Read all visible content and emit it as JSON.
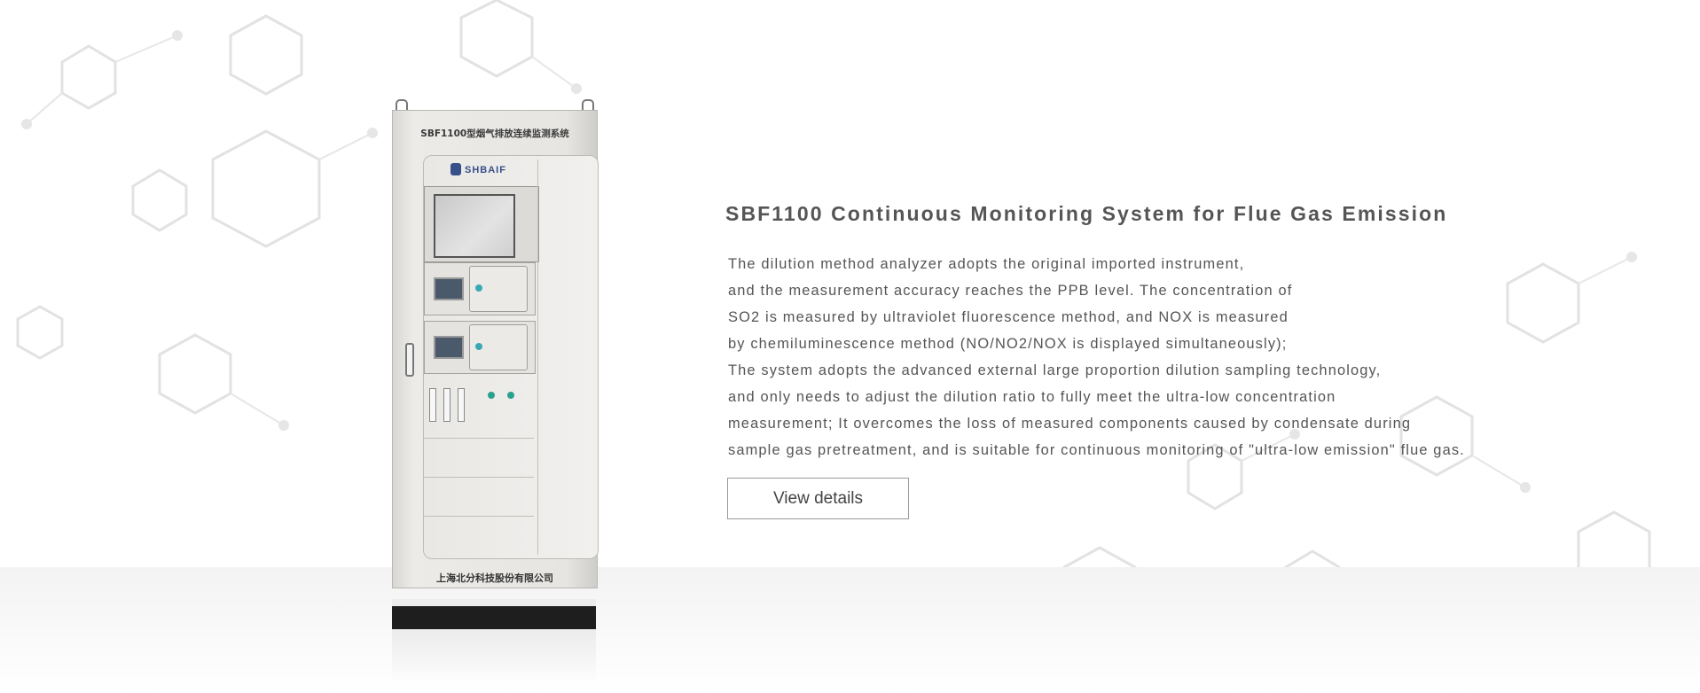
{
  "product": {
    "title": "SBF1100 Continuous Monitoring System for Flue Gas Emission",
    "description_lines": [
      "The dilution method analyzer adopts the original imported instrument,",
      "and the measurement accuracy reaches the PPB level. The concentration of",
      "SO2 is measured by ultraviolet fluorescence method, and NOX is measured",
      "by chemiluminescence method (NO/NO2/NOX is displayed simultaneously);",
      "The system adopts the advanced external large proportion dilution sampling technology,",
      "and only needs to adjust the dilution ratio to fully meet the ultra-low concentration",
      "measurement; It overcomes the loss of measured components caused by condensate during",
      "sample gas pretreatment, and is suitable for continuous monitoring of \"ultra-low emission\" flue gas."
    ],
    "button_label": "View details"
  },
  "cabinet_image": {
    "top_label": "SBF1100型烟气排放连续监测系统",
    "logo_text": "SHBAIF",
    "bottom_label": "上海北分科技股份有限公司"
  }
}
